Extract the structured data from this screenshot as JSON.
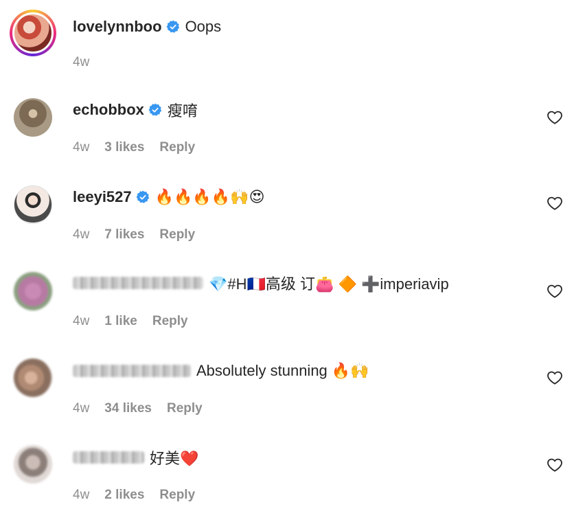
{
  "comments": [
    {
      "username": "lovelynnboo",
      "verified": true,
      "text": "Oops",
      "time": "4w",
      "likes": "",
      "reply": "",
      "heart": false
    },
    {
      "username": "echobbox",
      "verified": true,
      "text": "瘦唷",
      "time": "4w",
      "likes": "3 likes",
      "reply": "Reply",
      "heart": true
    },
    {
      "username": "leeyi527",
      "verified": true,
      "text": "🔥🔥🔥🔥🙌😍",
      "time": "4w",
      "likes": "7 likes",
      "reply": "Reply",
      "heart": true
    },
    {
      "username": "",
      "verified": false,
      "text": "💎#H🇫🇷高级 订👛 🔶 ➕imperiavip",
      "time": "4w",
      "likes": "1 like",
      "reply": "Reply",
      "heart": true
    },
    {
      "username": "",
      "verified": false,
      "text": "Absolutely stunning 🔥🙌",
      "time": "4w",
      "likes": "34 likes",
      "reply": "Reply",
      "heart": true
    },
    {
      "username": "",
      "verified": false,
      "text": "好美❤️",
      "time": "4w",
      "likes": "2 likes",
      "reply": "Reply",
      "heart": true
    }
  ],
  "colors": {
    "verified": "#3897f0",
    "text": "#262626",
    "meta": "#8e8e8e"
  },
  "icons": {
    "verified": "verified-badge-icon",
    "like": "heart-outline-icon"
  }
}
